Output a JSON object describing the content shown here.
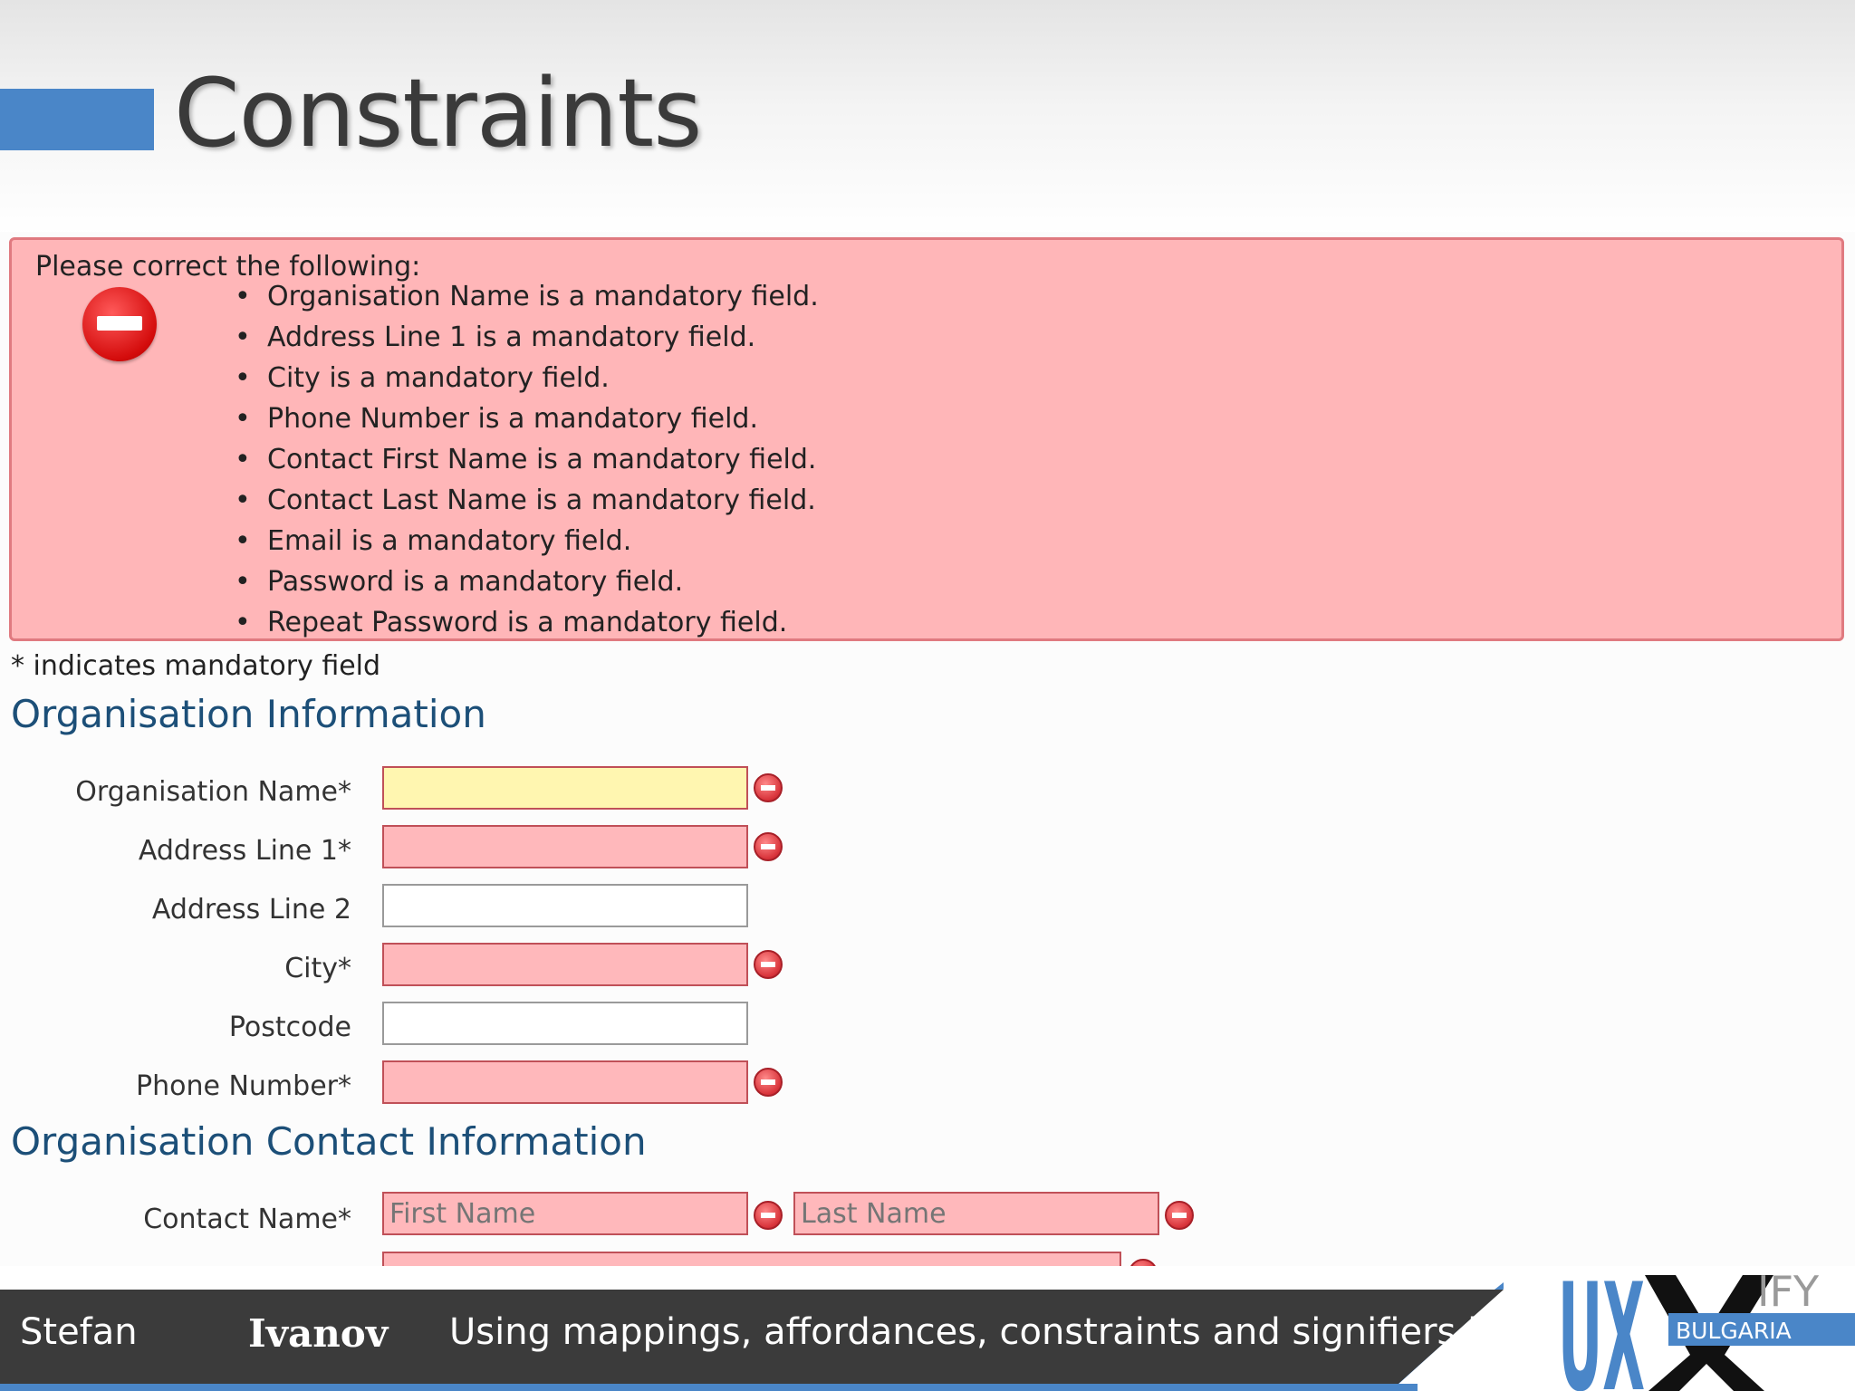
{
  "slide": {
    "title": "Constraints"
  },
  "form": {
    "error_heading": "Please correct the following:",
    "errors": [
      "Organisation Name is a mandatory field.",
      "Address Line 1 is a mandatory field.",
      "City is a mandatory field.",
      "Phone Number is a mandatory field.",
      "Contact First Name is a mandatory field.",
      "Contact Last Name is a mandatory field.",
      "Email is a mandatory field.",
      "Password is a mandatory field.",
      "Repeat Password is a mandatory field."
    ],
    "mandatory_note": "* indicates mandatory field",
    "section_org": "Organisation Information",
    "fields": [
      {
        "label": "Organisation Name*",
        "value": "",
        "state": "active"
      },
      {
        "label": "Address Line 1*",
        "value": "",
        "state": "error"
      },
      {
        "label": "Address Line 2",
        "value": "",
        "state": "normal"
      },
      {
        "label": "City*",
        "value": "",
        "state": "error"
      },
      {
        "label": "Postcode",
        "value": "",
        "state": "normal"
      },
      {
        "label": "Phone Number*",
        "value": "",
        "state": "error"
      }
    ],
    "section_contact": "Organisation Contact Information",
    "contact": {
      "label": "Contact Name*",
      "first_placeholder": "First Name",
      "last_placeholder": "Last Name"
    }
  },
  "footer": {
    "first_name": "Stefan",
    "last_name": "Ivanov",
    "talk_title": "Using mappings, affordances, constraints and signifiers in UX"
  },
  "logo": {
    "text_ux": "UX",
    "text_ify": "IFY",
    "text_country": "BULGARIA"
  },
  "colors": {
    "accent": "#4a86c8",
    "error_bg": "#ffb6b8",
    "active_field": "#fff6b0",
    "heading_blue": "#1c4f78",
    "footer_dark": "#3b3b3b"
  }
}
